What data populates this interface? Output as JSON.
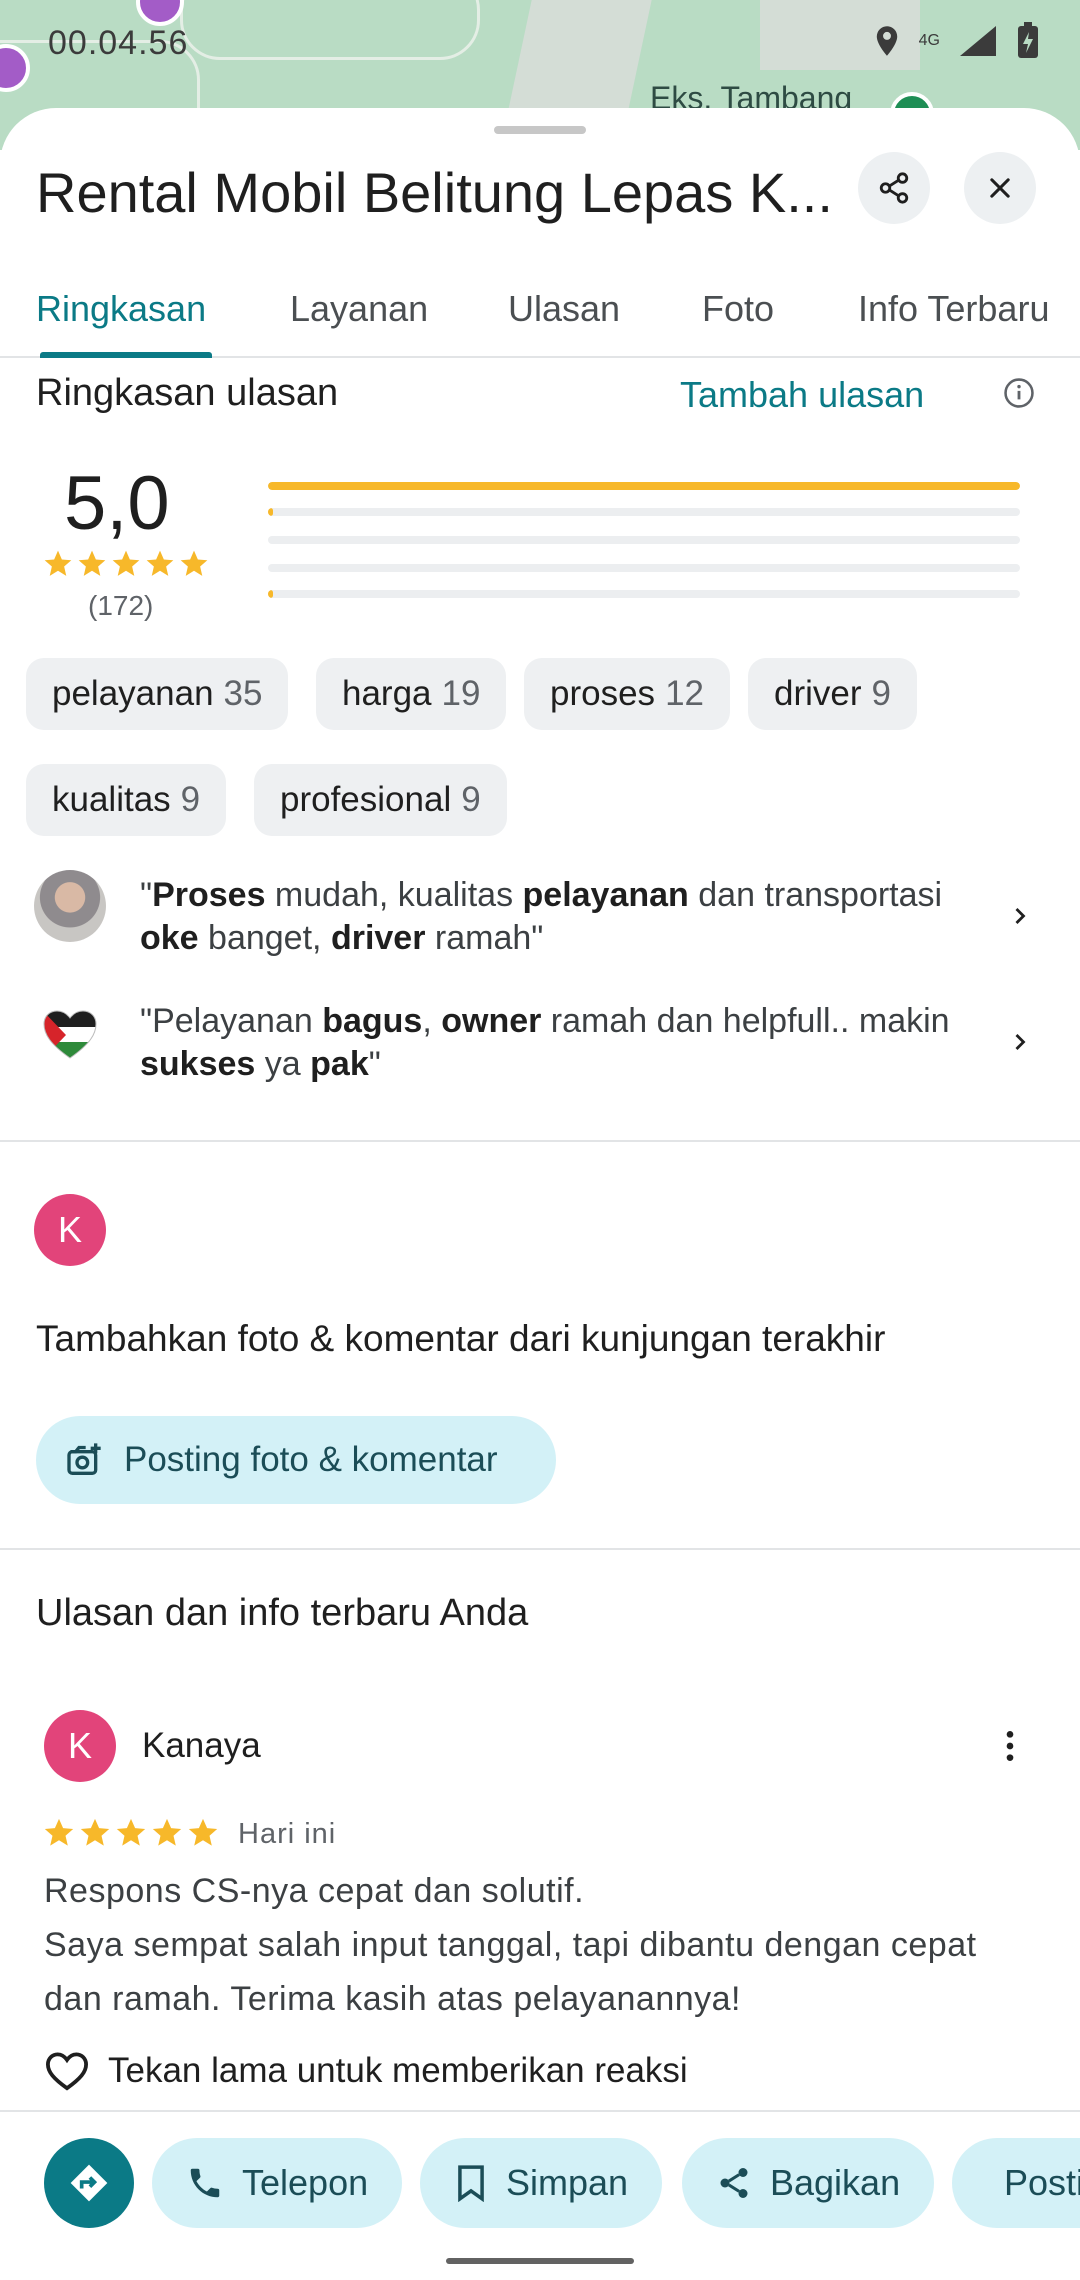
{
  "status_bar": {
    "time": "00.04.56",
    "network": "4G"
  },
  "map": {
    "place_label": "Eks. Tambang"
  },
  "place": {
    "title": "Rental Mobil Belitung Lepas K..."
  },
  "tabs": [
    {
      "label": "Ringkasan",
      "active": true
    },
    {
      "label": "Layanan"
    },
    {
      "label": "Ulasan"
    },
    {
      "label": "Foto"
    },
    {
      "label": "Info Terbaru"
    }
  ],
  "review_summary": {
    "heading": "Ringkasan ulasan",
    "add_review": "Tambah ulasan",
    "rating": "5,0",
    "review_count": "(172)",
    "distribution": [
      {
        "stars": 5,
        "fraction": 1.0
      },
      {
        "stars": 4,
        "fraction": 0.005
      },
      {
        "stars": 3,
        "fraction": 0.0
      },
      {
        "stars": 2,
        "fraction": 0.0
      },
      {
        "stars": 1,
        "fraction": 0.005
      }
    ]
  },
  "chips": [
    {
      "label": "pelayanan",
      "count": "35"
    },
    {
      "label": "harga",
      "count": "19"
    },
    {
      "label": "proses",
      "count": "12"
    },
    {
      "label": "driver",
      "count": "9"
    },
    {
      "label": "kualitas",
      "count": "9"
    },
    {
      "label": "profesional",
      "count": "9"
    }
  ],
  "snippets": [
    {
      "parts": [
        "\"",
        "Proses",
        " mudah, kualitas ",
        "pelayanan",
        " dan transportasi ",
        "oke",
        " banget, ",
        "driver",
        " ramah\""
      ]
    },
    {
      "parts": [
        "\"Pelayanan ",
        "bagus",
        ", ",
        "owner",
        " ramah dan helpfull.. makin ",
        "sukses",
        " ya ",
        "pak",
        "\""
      ]
    }
  ],
  "add_visit": {
    "avatar_letter": "K",
    "heading": "Tambahkan foto & komentar dari kunjungan terakhir",
    "button": "Posting foto & komentar"
  },
  "your_reviews": {
    "heading": "Ulasan dan info terbaru Anda",
    "reviewer": "Kanaya",
    "avatar_letter": "K",
    "stars": 5,
    "date": "Hari ini",
    "text_line1": "Respons CS-nya cepat dan solutif.",
    "text_line2": "Saya sempat salah input tanggal, tapi dibantu dengan cepat dan ramah. Terima kasih atas pelayanannya!",
    "reaction_hint": "Tekan lama untuk memberikan reaksi"
  },
  "actions": {
    "call": "Telepon",
    "save": "Simpan",
    "share": "Bagikan",
    "post": "Posting"
  },
  "colors": {
    "accent": "#0b7a86",
    "star": "#f7b82a",
    "chip_bg": "#eef0f2",
    "pill_bg": "#d3f1f7",
    "avatar": "#e2447a"
  }
}
